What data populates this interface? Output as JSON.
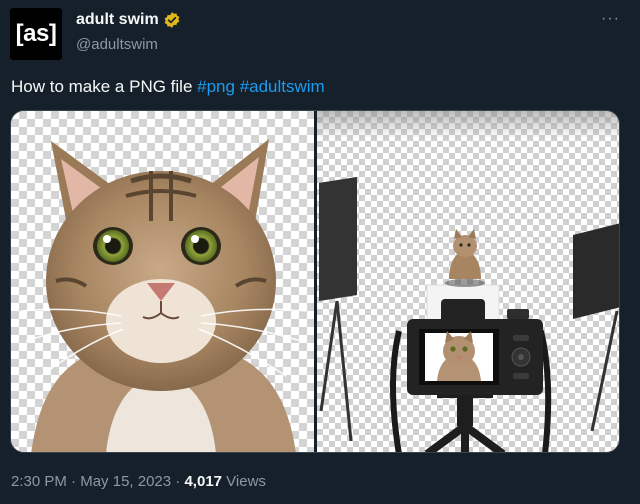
{
  "author": {
    "avatar_text": "[as]",
    "display_name": "adult swim",
    "handle": "@adultswim",
    "verified_badge_color": "#e2b719"
  },
  "more_label": "···",
  "tweet": {
    "text": "How to make a PNG file ",
    "hashtags": [
      "#png",
      "#adultswim"
    ]
  },
  "media": {
    "left_image_icon": "cat-cutout-image",
    "right_image_icon": "photo-studio-camera-image"
  },
  "meta": {
    "time": "2:30 PM",
    "separator": " · ",
    "date": "May 15, 2023",
    "views_count": "4,017",
    "views_label": " Views"
  },
  "colors": {
    "background": "#15202b",
    "text": "#f7f9f9",
    "secondary_text": "#8b98a5",
    "link": "#1d9bf0"
  }
}
